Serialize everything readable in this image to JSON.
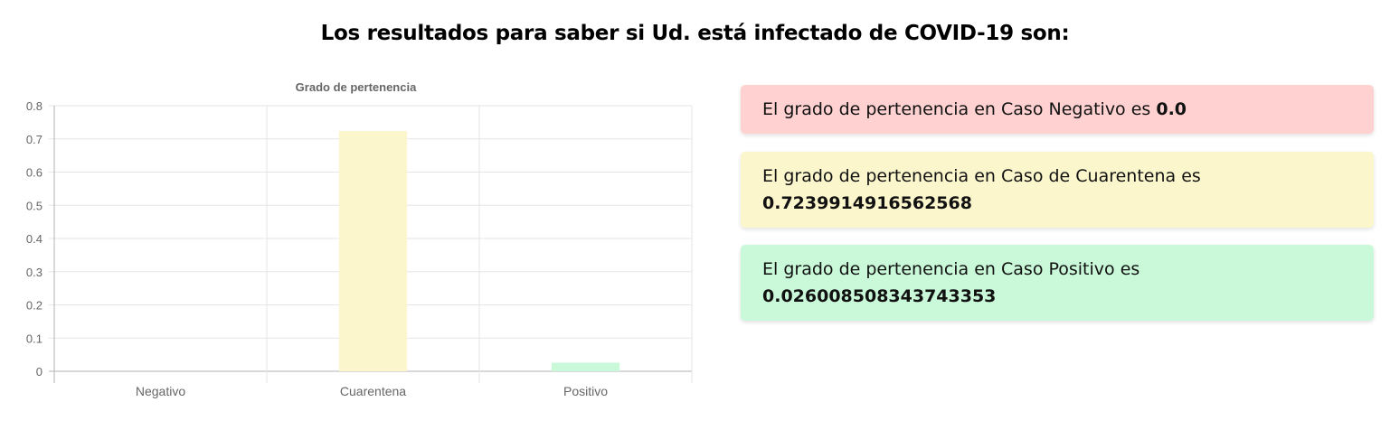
{
  "page": {
    "title": "Los resultados para saber si Ud. está infectado de COVID-19 son:"
  },
  "colors": {
    "negative_bg": "#ffd1d1",
    "quarantine_bg": "#fcf6cc",
    "positive_bg": "#c9f9d8",
    "grid": "#e5e5e5",
    "axis": "#b3b3b3"
  },
  "chart_data": {
    "type": "bar",
    "title": "Grado de pertenencia",
    "categories": [
      "Negativo",
      "Cuarentena",
      "Positivo"
    ],
    "values": [
      0.0,
      0.7239914916562568,
      0.026008508343743353
    ],
    "bar_colors": [
      "#ffd1d1",
      "#fcf6cc",
      "#c9f9d8"
    ],
    "ylim": [
      0,
      0.8
    ],
    "yticks": [
      "0.8",
      "0.7",
      "0.6",
      "0.5",
      "0.4",
      "0.3",
      "0.2",
      "0.1",
      "0"
    ],
    "grid": true,
    "legend": "none"
  },
  "results": [
    {
      "prefix": "El grado de pertenencia en Caso Negativo es ",
      "value": "0.0"
    },
    {
      "prefix": "El grado de pertenencia en Caso de Cuarentena es ",
      "value": "0.7239914916562568"
    },
    {
      "prefix": "El grado de pertenencia en Caso Positivo es ",
      "value": "0.026008508343743353"
    }
  ]
}
